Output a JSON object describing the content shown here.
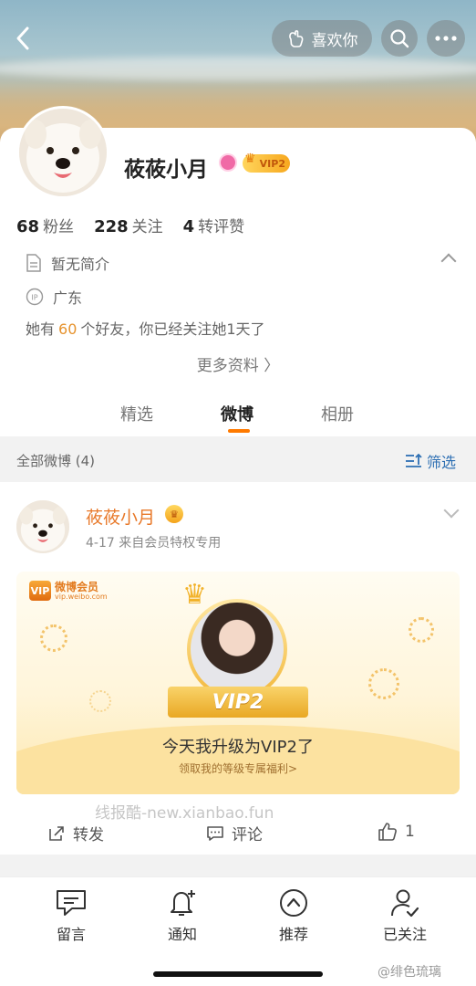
{
  "header": {
    "like_label": "喜欢你",
    "icons": [
      "back-icon",
      "heart-hand-icon",
      "search-icon",
      "more-icon"
    ]
  },
  "profile": {
    "name": "莜莜小月",
    "vip_badge": "VIP2",
    "stats": [
      {
        "value": "68",
        "label": "粉丝"
      },
      {
        "value": "228",
        "label": "关注"
      },
      {
        "value": "4",
        "label": "转评赞"
      }
    ],
    "bio": "暂无简介",
    "ip_location": "广东",
    "friends": {
      "prefix": "她有",
      "count": "60",
      "suffix": "个好友，你已经关注她1天了"
    },
    "more_info": "更多资料 〉"
  },
  "tabs": [
    {
      "label": "精选",
      "active": false
    },
    {
      "label": "微博",
      "active": true
    },
    {
      "label": "相册",
      "active": false
    }
  ],
  "feed": {
    "title": "全部微博 (4)",
    "filter": "筛选"
  },
  "post": {
    "author": "莜莜小月",
    "meta": "4-17  来自会员特权专用",
    "card": {
      "brand_cn": "微博会员",
      "brand_url": "vip.weibo.com",
      "vip_level": "VIP2",
      "headline": "今天我升级为VIP2了",
      "sub": "领取我的等级专属福利>"
    },
    "actions": {
      "repost": "转发",
      "comment": "评论",
      "likes": "1"
    }
  },
  "watermark": "线报酷-new.xianbao.fun",
  "bottom_nav": [
    {
      "label": "留言",
      "icon": "message-icon"
    },
    {
      "label": "通知",
      "icon": "bell-plus-icon"
    },
    {
      "label": "推荐",
      "icon": "recommend-icon"
    },
    {
      "label": "已关注",
      "icon": "user-check-icon"
    }
  ],
  "corner_mark": "@绯色琉璃",
  "colors": {
    "accent": "#ff7a00",
    "link": "#2d6fb3",
    "name_orange": "#e8792a",
    "number_orange": "#e6932e"
  }
}
